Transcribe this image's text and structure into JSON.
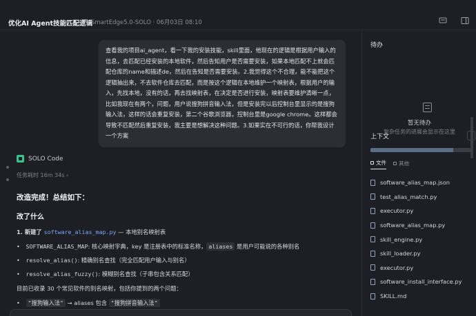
{
  "header": {
    "title": "优化AI Agent技能匹配逻辑",
    "meta": "SmartEdge5.0-SOLO · 06月03日 08:10"
  },
  "user_message": "查看我的项目ai_agent，看一下我的安装技能，skill里面，他现在的逻辑是根据用户输入的信息，去匹配已经安装的本地软件，然后告知用户是否需要安装，如果本地匹配不上就会匹配仓库的name和描述de，然后在告知是否需要安装。2.我觉得这个不合理，能不能把这个逻辑抽出来，不去软件仓库去匹配，而是按这个逻辑在本地维护一个映射表，根据用户的输入，先找本地，没有的话，再去找映射表，在决定是否进行安装，映射表要维护清晰一点，比如我现在有两个，问题，用户说搜狗拼音输入法，但是安装完以后控制台里显示的是搜狗输入法，这样的话会重复安装，第二个谷歌浏览器，控制台里是google chrome。这样都会导致不匹配然后重复安装，我主要是想解决这种问题。3.如果实在不可行的话，你帮我设计一个方案",
  "agent": {
    "name": "SOLO Code",
    "elapsed": "任务耗时 16m 34s",
    "elapsed_arrow": "›"
  },
  "response": {
    "heading": "改造完成！总结如下：",
    "subheading": "改了什么",
    "item1_prefix": "1. 新建了 ",
    "item1_code": "software_alias_map.py",
    "item1_suffix": " — 本地别名映射表",
    "bullet1_code": "SOFTWARE_ALIAS_MAP",
    "bullet1_text_a": ": 核心映射字典，key 是注册表中的标准名称，",
    "bullet1_chip": "aliases",
    "bullet1_text_b": " 是用户可能说的各种别名",
    "bullet2_code": "resolve_alias()",
    "bullet2_text": ": 精确别名查找（完全匹配用户输入与别名）",
    "bullet3_code": "resolve_alias_fuzzy()",
    "bullet3_text": ": 模糊别名查找（子串包含关系匹配）",
    "summary": "目前已收录 30 个常见软件的别名映射，包括你提到的两个问题：",
    "bullet4_code": "\"搜狗输入法\"",
    "bullet4_mid": " → aliases 包含 ",
    "bullet4_code2": "\"搜狗拼音输入法\""
  },
  "side": {
    "todo_title": "待办",
    "empty_title": "暂无待办",
    "empty_sub": "复杂任务的进展会显示在这里",
    "context_title": "上下文",
    "progress": 0.82,
    "tab_files": "文件",
    "tab_other": "其他",
    "files": [
      "software_alias_map.json",
      "test_alias_match.py",
      "executor.py",
      "software_alias_map.py",
      "skill_engine.py",
      "skill_loader.py",
      "executor.py",
      "software_install_interface.py",
      "SKILL.md"
    ]
  },
  "colors": {
    "background": "#1e1f24",
    "bubble": "#2c2e34",
    "accent_code": "#7aa7ff",
    "agent_logo": "#34c38f"
  }
}
